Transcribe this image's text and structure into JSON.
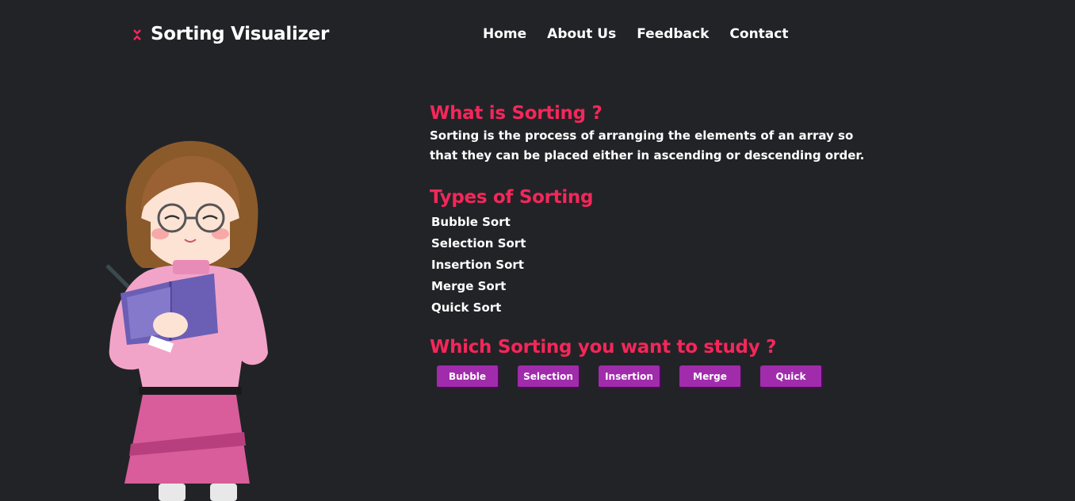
{
  "header": {
    "app_title": "Sorting Visualizer",
    "logo_icon": "sort-arrows-icon",
    "nav": [
      {
        "label": "Home"
      },
      {
        "label": "About Us"
      },
      {
        "label": "Feedback"
      },
      {
        "label": "Contact"
      }
    ]
  },
  "main": {
    "what_heading": "What is Sorting ?",
    "what_text": "Sorting is the process of arranging the elements of an array so that they can be placed either in ascending or descending order.",
    "types_heading": "Types of Sorting",
    "types": [
      "Bubble Sort",
      "Selection Sort",
      "Insertion Sort",
      "Merge Sort",
      "Quick Sort"
    ],
    "which_heading": "Which Sorting you want to study ?",
    "buttons": [
      "Bubble",
      "Selection",
      "Insertion",
      "Merge",
      "Quick"
    ]
  },
  "colors": {
    "background": "#222327",
    "accent": "#f4275a",
    "button": "#a02cab"
  }
}
